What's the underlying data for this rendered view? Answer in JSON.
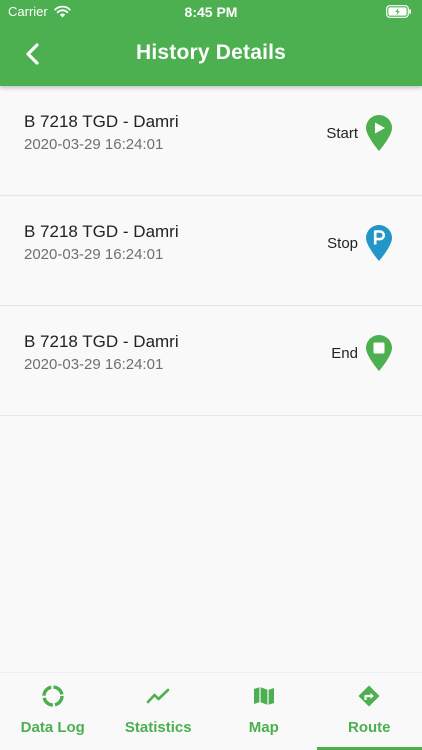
{
  "status_bar": {
    "carrier": "Carrier",
    "time": "8:45 PM",
    "wifi_icon": "wifi-icon",
    "battery_icon": "battery-charging-icon"
  },
  "app_bar": {
    "title": "History Details",
    "back_icon": "chevron-left-icon"
  },
  "colors": {
    "primary": "#4caf50",
    "stop_pin": "#2196c7",
    "text_primary": "#222222",
    "text_secondary": "#6f6f6f"
  },
  "history": [
    {
      "vehicle": "B 7218 TGD - Damri",
      "datetime": "2020-03-29 16:24:01",
      "status": "Start",
      "icon": "play-pin-icon"
    },
    {
      "vehicle": "B 7218 TGD - Damri",
      "datetime": "2020-03-29 16:24:01",
      "status": "Stop",
      "icon": "parking-pin-icon"
    },
    {
      "vehicle": "B 7218 TGD - Damri",
      "datetime": "2020-03-29 16:24:01",
      "status": "End",
      "icon": "stop-pin-icon"
    }
  ],
  "bottom_nav": {
    "items": [
      {
        "label": "Data Log",
        "icon": "data-log-icon"
      },
      {
        "label": "Statistics",
        "icon": "statistics-icon"
      },
      {
        "label": "Map",
        "icon": "map-icon"
      },
      {
        "label": "Route",
        "icon": "route-icon"
      }
    ],
    "active": "Route"
  }
}
